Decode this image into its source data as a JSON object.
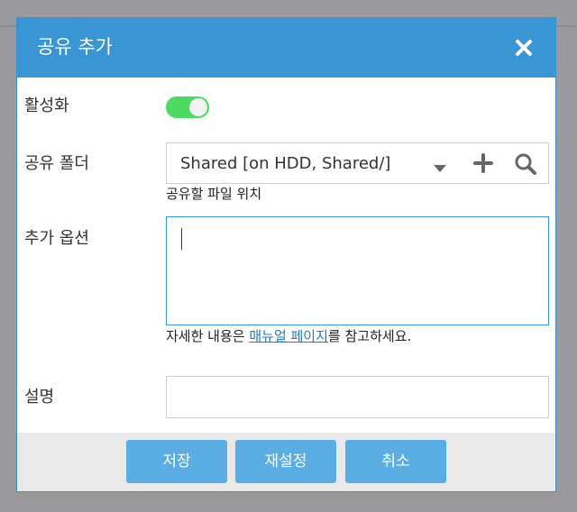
{
  "dialog": {
    "title": "공유 추가",
    "close_icon": "close-icon"
  },
  "colors": {
    "titlebar": "#3a95d5",
    "toggle_on": "#4cd964",
    "button": "#5aaee3",
    "link": "#1a7dc4"
  },
  "form": {
    "active": {
      "label": "활성화",
      "value": true
    },
    "share_folder": {
      "label": "공유 폴더",
      "selected": "Shared [on HDD, Shared/]",
      "help": "공유할 파일 위치",
      "icons": [
        "chevron-down-icon",
        "plus-icon",
        "search-icon"
      ]
    },
    "extra_options": {
      "label": "추가 옵션",
      "value": "",
      "help_prefix": "자세한 내용은 ",
      "help_link": "매뉴얼 페이지",
      "help_suffix": "를 참고하세요."
    },
    "description": {
      "label": "설명",
      "value": ""
    }
  },
  "footer": {
    "save_label": "저장",
    "reset_label": "재설정",
    "cancel_label": "취소"
  }
}
